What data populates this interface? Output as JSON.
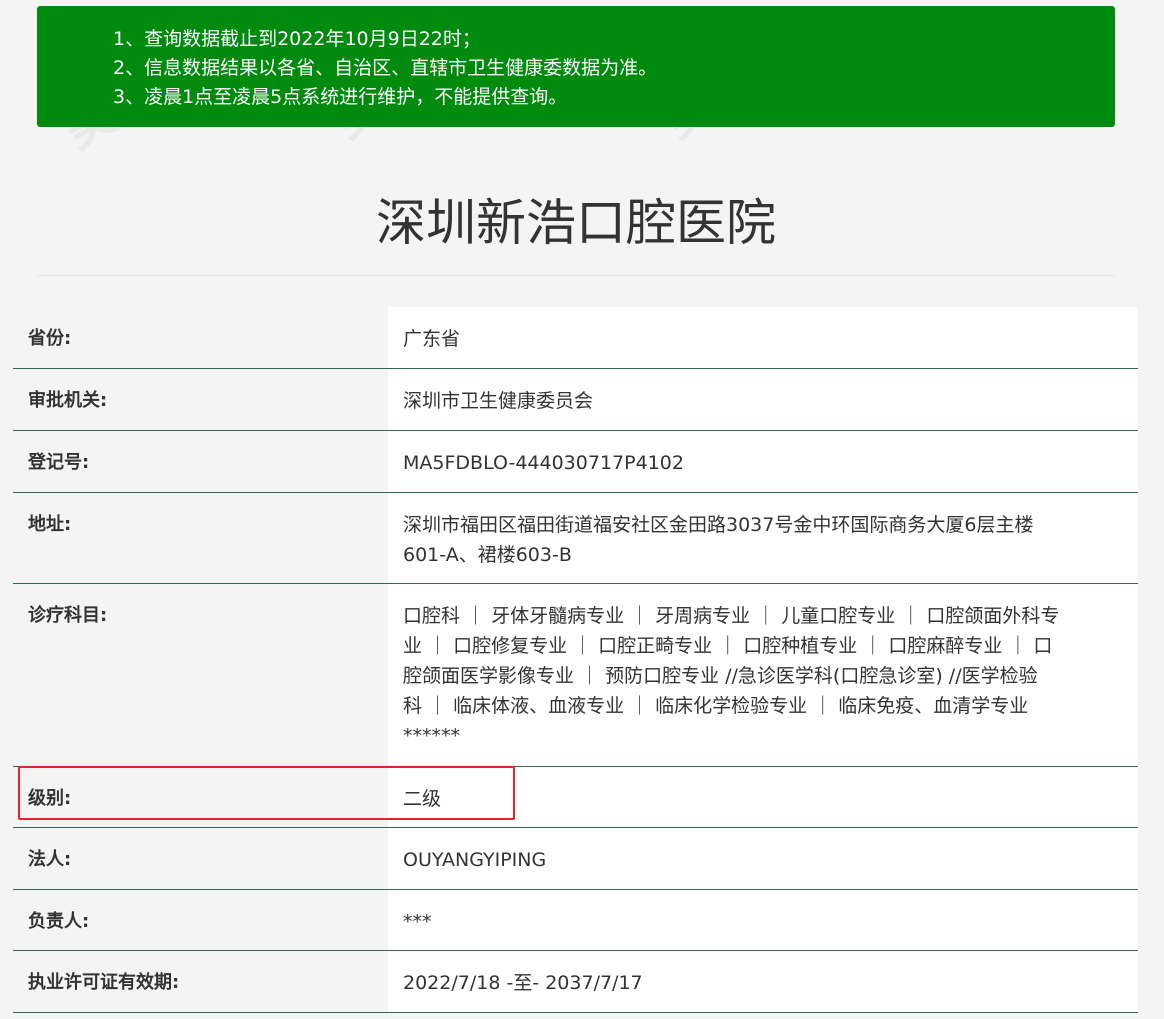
{
  "notice": {
    "lines": [
      "1、查询数据截止到2022年10月9日22时；",
      "2、信息数据结果以各省、自治区、直辖市卫生健康委数据为准。",
      "3、凌晨1点至凌晨5点系统进行维护，不能提供查询。"
    ]
  },
  "page_title": "深圳新浩口腔医院",
  "watermark": "美佳",
  "colors": {
    "notice_bg": "#008a0e",
    "highlight": "#e2252b",
    "row_border": "#2f6b4a"
  },
  "rows": [
    {
      "label": "省份:",
      "value": "广东省"
    },
    {
      "label": "审批机关:",
      "value": "深圳市卫生健康委员会"
    },
    {
      "label": "登记号:",
      "value": "MA5FDBLO-444030717P4102"
    },
    {
      "label": "地址:",
      "value_lines": [
        "深圳市福田区福田街道福安社区金田路3037号金中环国际商务大厦6层主楼",
        "601-A、裙楼603-B"
      ]
    },
    {
      "label": "诊疗科目:",
      "value_lines": [
        "口腔科 ｜ 牙体牙髓病专业 ｜ 牙周病专业 ｜ 儿童口腔专业 ｜ 口腔颌面外科专",
        "业 ｜ 口腔修复专业 ｜ 口腔正畸专业 ｜ 口腔种植专业 ｜ 口腔麻醉专业 ｜ 口",
        "腔颌面医学影像专业 ｜ 预防口腔专业 //急诊医学科(口腔急诊室) //医学检验",
        "科 ｜ 临床体液、血液专业 ｜ 临床化学检验专业 ｜ 临床免疫、血清学专业",
        "******"
      ]
    },
    {
      "label": "级别:",
      "value": "二级"
    },
    {
      "label": "法人:",
      "value": "OUYANGYIPING"
    },
    {
      "label": "负责人:",
      "value": "***"
    },
    {
      "label": "执业许可证有效期:",
      "value": "2022/7/18 -至- 2037/7/17"
    }
  ]
}
